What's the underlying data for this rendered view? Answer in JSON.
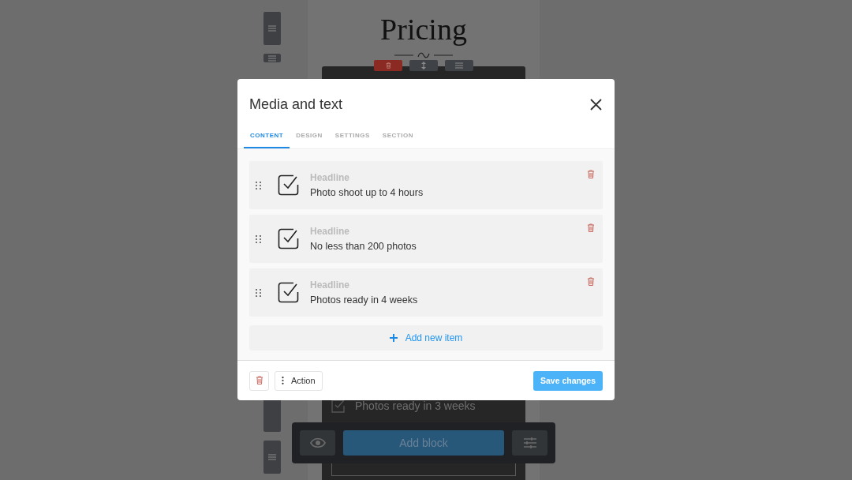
{
  "background": {
    "heading": "Pricing",
    "block_item": "Photos ready in 3 weeks",
    "add_block_button": "Add block"
  },
  "dialog": {
    "title": "Media and text",
    "tabs": [
      {
        "label": "CONTENT",
        "selected": true
      },
      {
        "label": "DESIGN",
        "selected": false
      },
      {
        "label": "SETTINGS",
        "selected": false
      },
      {
        "label": "SECTION",
        "selected": false
      }
    ],
    "items": [
      {
        "label": "Headline",
        "value": "Photo shoot up to 4 hours",
        "checked": true
      },
      {
        "label": "Headline",
        "value": "No less than 200 photos",
        "checked": true
      },
      {
        "label": "Headline",
        "value": "Photos ready in 4 weeks",
        "checked": true
      }
    ],
    "add_button": "Add new item",
    "action_button": "Action",
    "save_button": "Save changes"
  }
}
